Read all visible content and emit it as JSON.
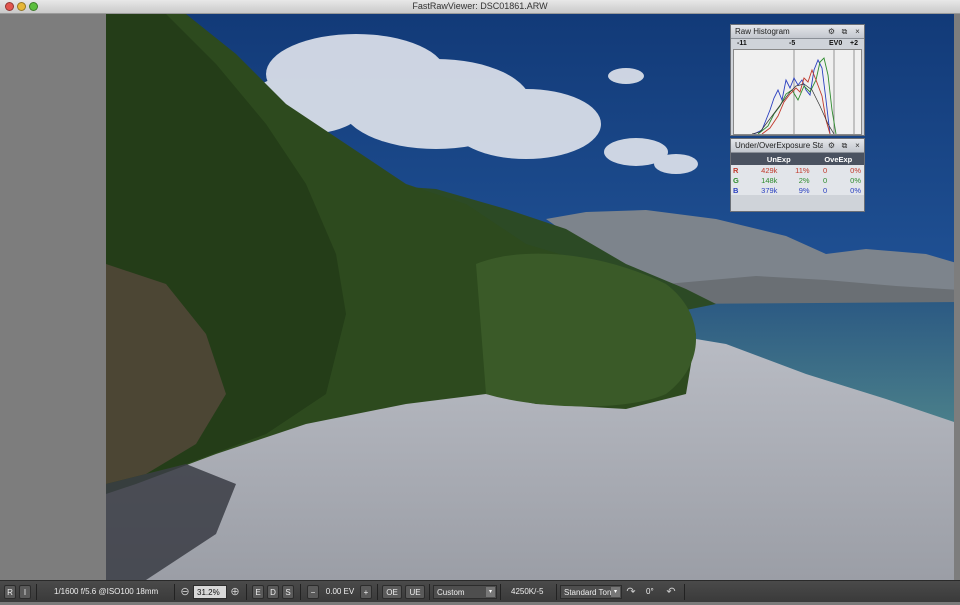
{
  "window": {
    "title": "FastRawViewer: DSC01861.ARW"
  },
  "histogram_panel": {
    "title": "Raw Histogram",
    "scale": [
      "-11",
      "-5",
      "EV0",
      "+2"
    ],
    "icons": [
      "gear-icon",
      "detach-icon",
      "close-icon"
    ]
  },
  "exposure_panel": {
    "title": "Under/OverExposure Stats",
    "headers": [
      "",
      "UnExp",
      "",
      "OveExp",
      ""
    ],
    "rows": [
      {
        "ch": "R",
        "un_count": "429k",
        "un_pct": "11%",
        "ov_count": "0",
        "ov_pct": "0%"
      },
      {
        "ch": "G",
        "un_count": "148k",
        "un_pct": "2%",
        "ov_count": "0",
        "ov_pct": "0%"
      },
      {
        "ch": "B",
        "un_count": "379k",
        "un_pct": "9%",
        "ov_count": "0",
        "ov_pct": "0%"
      }
    ],
    "colors": {
      "R": "#c0392b",
      "G": "#2e8b2e",
      "B": "#2a3fc0"
    }
  },
  "statusbar": {
    "r_label": "R",
    "i_label": "I",
    "exif": "1/1600 f/5.6 @ISO100 18mm",
    "zoom": "31.2%",
    "edit_e": "E",
    "edit_d": "D",
    "edit_s": "S",
    "ev_value": "0.00 EV",
    "oe_label": "OE",
    "ue_label": "UE",
    "wb_preset": "Custom",
    "wb_value": "4250K/-5",
    "tone_curve": "Standard Tone",
    "rotation": "0°"
  }
}
